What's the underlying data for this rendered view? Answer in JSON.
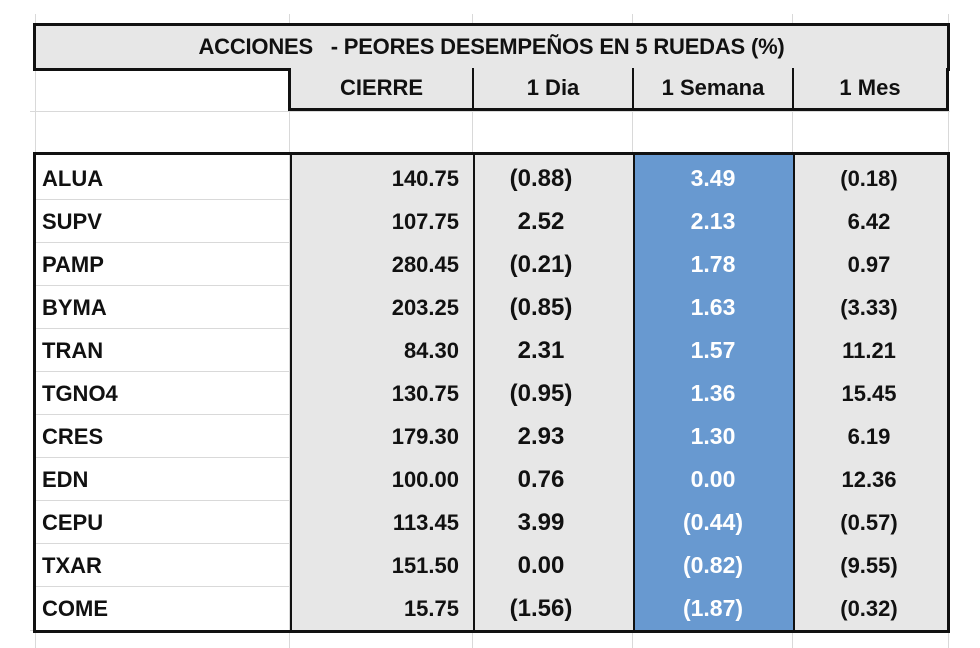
{
  "table": {
    "title": "ACCIONES   - PEORES DESEMPEÑOS EN 5 RUEDAS (%)",
    "headers": {
      "ticker": "",
      "cierre": "CIERRE",
      "dia": "1 Dia",
      "semana": "1 Semana",
      "mes": "1 Mes"
    },
    "colors": {
      "header_fill": "#e7e7e7",
      "highlight_column_fill": "#6899d0",
      "highlight_text": "#ffffff",
      "border": "#111111"
    },
    "rows": [
      {
        "ticker": "ALUA",
        "cierre": "140.75",
        "dia": "(0.88)",
        "semana": "3.49",
        "mes": "(0.18)"
      },
      {
        "ticker": "SUPV",
        "cierre": "107.75",
        "dia": "2.52",
        "semana": "2.13",
        "mes": "6.42"
      },
      {
        "ticker": "PAMP",
        "cierre": "280.45",
        "dia": "(0.21)",
        "semana": "1.78",
        "mes": "0.97"
      },
      {
        "ticker": "BYMA",
        "cierre": "203.25",
        "dia": "(0.85)",
        "semana": "1.63",
        "mes": "(3.33)"
      },
      {
        "ticker": "TRAN",
        "cierre": "84.30",
        "dia": "2.31",
        "semana": "1.57",
        "mes": "11.21"
      },
      {
        "ticker": "TGNO4",
        "cierre": "130.75",
        "dia": "(0.95)",
        "semana": "1.36",
        "mes": "15.45"
      },
      {
        "ticker": "CRES",
        "cierre": "179.30",
        "dia": "2.93",
        "semana": "1.30",
        "mes": "6.19"
      },
      {
        "ticker": "EDN",
        "cierre": "100.00",
        "dia": "0.76",
        "semana": "0.00",
        "mes": "12.36"
      },
      {
        "ticker": "CEPU",
        "cierre": "113.45",
        "dia": "3.99",
        "semana": "(0.44)",
        "mes": "(0.57)"
      },
      {
        "ticker": "TXAR",
        "cierre": "151.50",
        "dia": "0.00",
        "semana": "(0.82)",
        "mes": "(9.55)"
      },
      {
        "ticker": "COME",
        "cierre": "15.75",
        "dia": "(1.56)",
        "semana": "(1.87)",
        "mes": "(0.32)"
      }
    ]
  }
}
